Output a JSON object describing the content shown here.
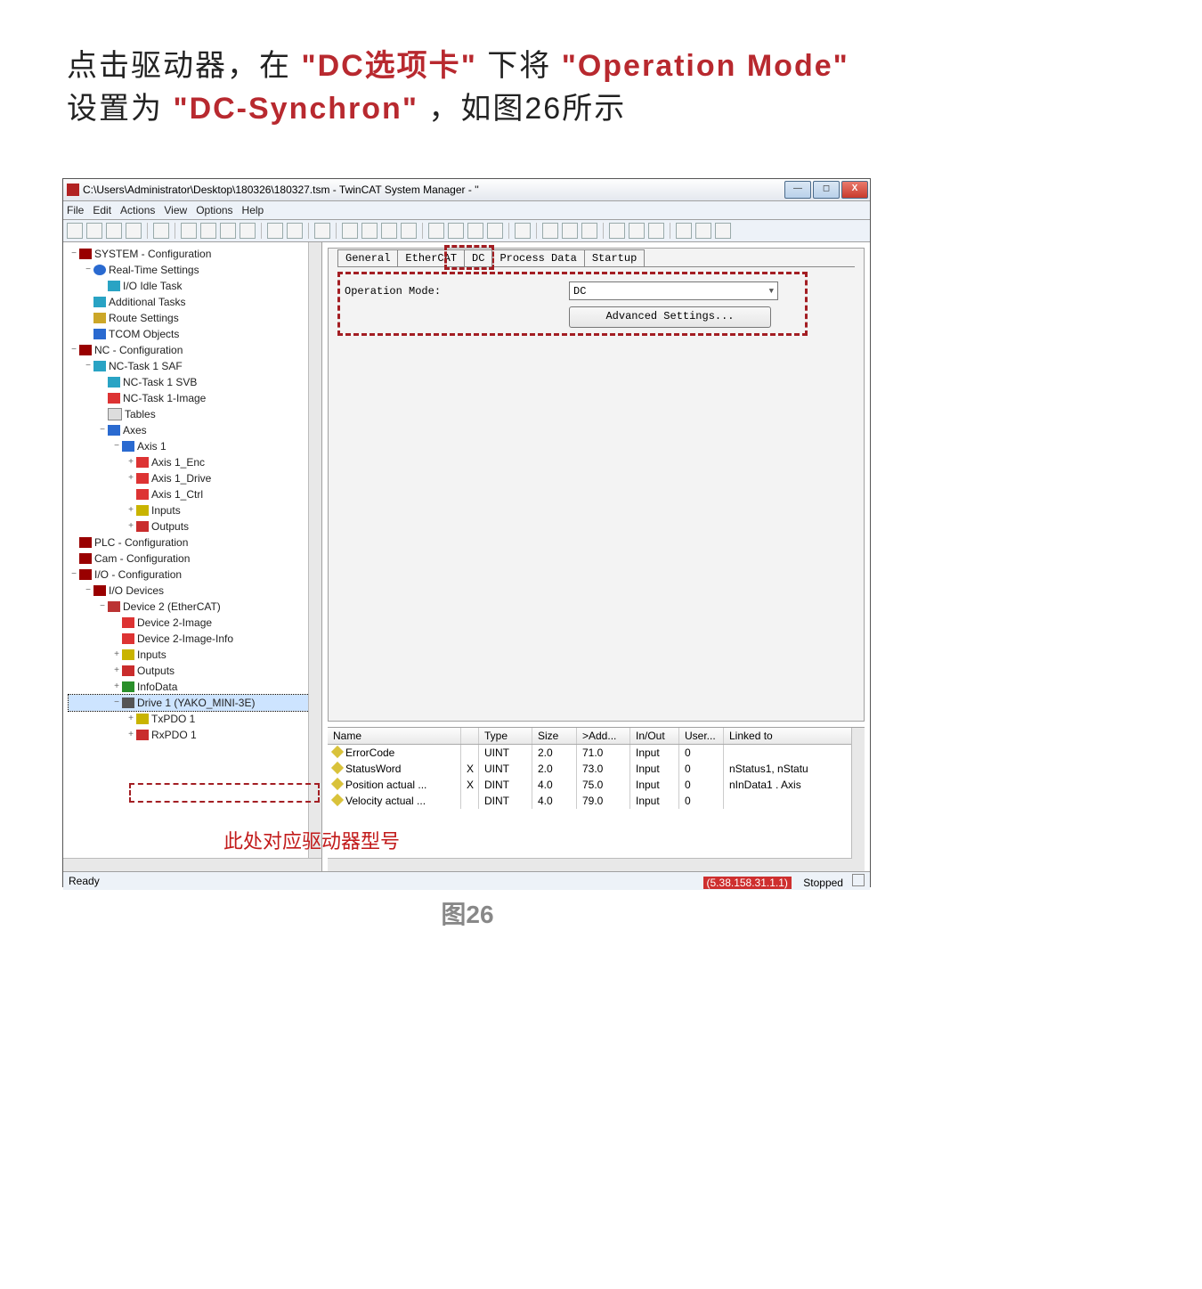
{
  "caption": {
    "t1": "点击驱动器，在",
    "q1": "\"",
    "hl1": "DC选项卡",
    "q2": "\"",
    "t2": "下将",
    "q3": "\"",
    "hl2": "Operation Mode",
    "q4": "\"",
    "t3": "设置为",
    "q5": "\"",
    "hl3": "DC-Synchron",
    "q6": "\"",
    "t4": "，如图26所示"
  },
  "figure_label": "图26",
  "window": {
    "title": "C:\\Users\\Administrator\\Desktop\\180326\\180327.tsm - TwinCAT System Manager - ''",
    "min": "—",
    "max": "◻",
    "close": "X"
  },
  "menu": {
    "file": "File",
    "edit": "Edit",
    "actions": "Actions",
    "view": "View",
    "options": "Options",
    "help": "Help"
  },
  "tabs": {
    "general": "General",
    "ethercat": "EtherCAT",
    "dc": "DC",
    "pd": "Process Data",
    "startup": "Startup"
  },
  "panel": {
    "op_label": "Operation Mode:",
    "op_value": "DC",
    "adv_btn": "Advanced Settings..."
  },
  "tree": [
    {
      "ind": 0,
      "tw": "−",
      "ico": "i-sys",
      "label": "SYSTEM - Configuration"
    },
    {
      "ind": 1,
      "tw": "−",
      "ico": "i-rt",
      "label": "Real-Time Settings"
    },
    {
      "ind": 2,
      "tw": "",
      "ico": "i-task",
      "label": "I/O Idle Task"
    },
    {
      "ind": 1,
      "tw": "",
      "ico": "i-task",
      "label": "Additional Tasks"
    },
    {
      "ind": 1,
      "tw": "",
      "ico": "i-route",
      "label": "Route Settings"
    },
    {
      "ind": 1,
      "tw": "",
      "ico": "i-tcom",
      "label": "TCOM Objects"
    },
    {
      "ind": 0,
      "tw": "−",
      "ico": "i-nc",
      "label": "NC - Configuration"
    },
    {
      "ind": 1,
      "tw": "−",
      "ico": "i-task",
      "label": "NC-Task 1 SAF"
    },
    {
      "ind": 2,
      "tw": "",
      "ico": "i-task",
      "label": "NC-Task 1 SVB"
    },
    {
      "ind": 2,
      "tw": "",
      "ico": "i-img",
      "label": "NC-Task 1-Image"
    },
    {
      "ind": 2,
      "tw": "",
      "ico": "i-tbl",
      "label": "Tables"
    },
    {
      "ind": 2,
      "tw": "−",
      "ico": "i-ax",
      "label": "Axes"
    },
    {
      "ind": 3,
      "tw": "−",
      "ico": "i-ax",
      "label": "Axis 1"
    },
    {
      "ind": 4,
      "tw": "+",
      "ico": "i-enc",
      "label": "Axis 1_Enc"
    },
    {
      "ind": 4,
      "tw": "+",
      "ico": "i-drv",
      "label": "Axis 1_Drive"
    },
    {
      "ind": 4,
      "tw": "",
      "ico": "i-ctrl",
      "label": "Axis 1_Ctrl"
    },
    {
      "ind": 4,
      "tw": "+",
      "ico": "i-in",
      "label": "Inputs"
    },
    {
      "ind": 4,
      "tw": "+",
      "ico": "i-out",
      "label": "Outputs"
    },
    {
      "ind": 0,
      "tw": "",
      "ico": "i-plc",
      "label": "PLC - Configuration"
    },
    {
      "ind": 0,
      "tw": "",
      "ico": "i-cam",
      "label": "Cam - Configuration"
    },
    {
      "ind": 0,
      "tw": "−",
      "ico": "i-io",
      "label": "I/O - Configuration"
    },
    {
      "ind": 1,
      "tw": "−",
      "ico": "i-dev",
      "label": "I/O Devices"
    },
    {
      "ind": 2,
      "tw": "−",
      "ico": "i-eth",
      "label": "Device 2 (EtherCAT)"
    },
    {
      "ind": 3,
      "tw": "",
      "ico": "i-img",
      "label": "Device 2-Image"
    },
    {
      "ind": 3,
      "tw": "",
      "ico": "i-img",
      "label": "Device 2-Image-Info"
    },
    {
      "ind": 3,
      "tw": "+",
      "ico": "i-in",
      "label": "Inputs"
    },
    {
      "ind": 3,
      "tw": "+",
      "ico": "i-out",
      "label": "Outputs"
    },
    {
      "ind": 3,
      "tw": "+",
      "ico": "i-info",
      "label": "InfoData"
    },
    {
      "ind": 3,
      "tw": "−",
      "ico": "i-drive",
      "label": "Drive 1 (YAKO_MINI-3E)",
      "sel": true
    },
    {
      "ind": 4,
      "tw": "+",
      "ico": "i-pdo",
      "label": "TxPDO 1"
    },
    {
      "ind": 4,
      "tw": "+",
      "ico": "i-pdor",
      "label": "RxPDO 1"
    }
  ],
  "list": {
    "headers": {
      "name": "Name",
      "type": "Type",
      "size": "Size",
      "add": ">Add...",
      "io": "In/Out",
      "user": "User...",
      "link": "Linked to"
    },
    "rows": [
      {
        "name": "ErrorCode",
        "x": "",
        "type": "UINT",
        "size": "2.0",
        "add": "71.0",
        "io": "Input",
        "user": "0",
        "link": ""
      },
      {
        "name": "StatusWord",
        "x": "X",
        "type": "UINT",
        "size": "2.0",
        "add": "73.0",
        "io": "Input",
        "user": "0",
        "link": "nStatus1, nStatu"
      },
      {
        "name": "Position actual ...",
        "x": "X",
        "type": "DINT",
        "size": "4.0",
        "add": "75.0",
        "io": "Input",
        "user": "0",
        "link": "nInData1 . Axis"
      },
      {
        "name": "Velocity actual ...",
        "x": "",
        "type": "DINT",
        "size": "4.0",
        "add": "79.0",
        "io": "Input",
        "user": "0",
        "link": ""
      }
    ]
  },
  "status": {
    "ready": "Ready",
    "ip": "(5.38.158.31.1.1)",
    "state": "Stopped"
  },
  "annotation": "此处对应驱动器型号"
}
